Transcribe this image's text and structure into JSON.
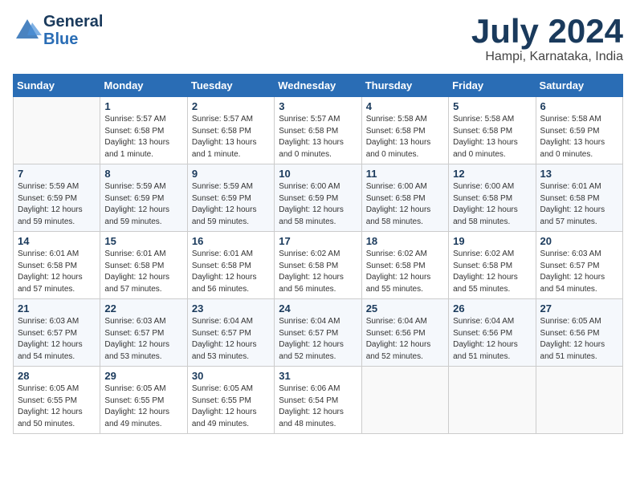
{
  "header": {
    "logo_general": "General",
    "logo_blue": "Blue",
    "title": "July 2024",
    "location": "Hampi, Karnataka, India"
  },
  "days_of_week": [
    "Sunday",
    "Monday",
    "Tuesday",
    "Wednesday",
    "Thursday",
    "Friday",
    "Saturday"
  ],
  "weeks": [
    [
      {
        "day": "",
        "info": ""
      },
      {
        "day": "1",
        "info": "Sunrise: 5:57 AM\nSunset: 6:58 PM\nDaylight: 13 hours\nand 1 minute."
      },
      {
        "day": "2",
        "info": "Sunrise: 5:57 AM\nSunset: 6:58 PM\nDaylight: 13 hours\nand 1 minute."
      },
      {
        "day": "3",
        "info": "Sunrise: 5:57 AM\nSunset: 6:58 PM\nDaylight: 13 hours\nand 0 minutes."
      },
      {
        "day": "4",
        "info": "Sunrise: 5:58 AM\nSunset: 6:58 PM\nDaylight: 13 hours\nand 0 minutes."
      },
      {
        "day": "5",
        "info": "Sunrise: 5:58 AM\nSunset: 6:58 PM\nDaylight: 13 hours\nand 0 minutes."
      },
      {
        "day": "6",
        "info": "Sunrise: 5:58 AM\nSunset: 6:59 PM\nDaylight: 13 hours\nand 0 minutes."
      }
    ],
    [
      {
        "day": "7",
        "info": "Sunrise: 5:59 AM\nSunset: 6:59 PM\nDaylight: 12 hours\nand 59 minutes."
      },
      {
        "day": "8",
        "info": "Sunrise: 5:59 AM\nSunset: 6:59 PM\nDaylight: 12 hours\nand 59 minutes."
      },
      {
        "day": "9",
        "info": "Sunrise: 5:59 AM\nSunset: 6:59 PM\nDaylight: 12 hours\nand 59 minutes."
      },
      {
        "day": "10",
        "info": "Sunrise: 6:00 AM\nSunset: 6:59 PM\nDaylight: 12 hours\nand 58 minutes."
      },
      {
        "day": "11",
        "info": "Sunrise: 6:00 AM\nSunset: 6:58 PM\nDaylight: 12 hours\nand 58 minutes."
      },
      {
        "day": "12",
        "info": "Sunrise: 6:00 AM\nSunset: 6:58 PM\nDaylight: 12 hours\nand 58 minutes."
      },
      {
        "day": "13",
        "info": "Sunrise: 6:01 AM\nSunset: 6:58 PM\nDaylight: 12 hours\nand 57 minutes."
      }
    ],
    [
      {
        "day": "14",
        "info": "Sunrise: 6:01 AM\nSunset: 6:58 PM\nDaylight: 12 hours\nand 57 minutes."
      },
      {
        "day": "15",
        "info": "Sunrise: 6:01 AM\nSunset: 6:58 PM\nDaylight: 12 hours\nand 57 minutes."
      },
      {
        "day": "16",
        "info": "Sunrise: 6:01 AM\nSunset: 6:58 PM\nDaylight: 12 hours\nand 56 minutes."
      },
      {
        "day": "17",
        "info": "Sunrise: 6:02 AM\nSunset: 6:58 PM\nDaylight: 12 hours\nand 56 minutes."
      },
      {
        "day": "18",
        "info": "Sunrise: 6:02 AM\nSunset: 6:58 PM\nDaylight: 12 hours\nand 55 minutes."
      },
      {
        "day": "19",
        "info": "Sunrise: 6:02 AM\nSunset: 6:58 PM\nDaylight: 12 hours\nand 55 minutes."
      },
      {
        "day": "20",
        "info": "Sunrise: 6:03 AM\nSunset: 6:57 PM\nDaylight: 12 hours\nand 54 minutes."
      }
    ],
    [
      {
        "day": "21",
        "info": "Sunrise: 6:03 AM\nSunset: 6:57 PM\nDaylight: 12 hours\nand 54 minutes."
      },
      {
        "day": "22",
        "info": "Sunrise: 6:03 AM\nSunset: 6:57 PM\nDaylight: 12 hours\nand 53 minutes."
      },
      {
        "day": "23",
        "info": "Sunrise: 6:04 AM\nSunset: 6:57 PM\nDaylight: 12 hours\nand 53 minutes."
      },
      {
        "day": "24",
        "info": "Sunrise: 6:04 AM\nSunset: 6:57 PM\nDaylight: 12 hours\nand 52 minutes."
      },
      {
        "day": "25",
        "info": "Sunrise: 6:04 AM\nSunset: 6:56 PM\nDaylight: 12 hours\nand 52 minutes."
      },
      {
        "day": "26",
        "info": "Sunrise: 6:04 AM\nSunset: 6:56 PM\nDaylight: 12 hours\nand 51 minutes."
      },
      {
        "day": "27",
        "info": "Sunrise: 6:05 AM\nSunset: 6:56 PM\nDaylight: 12 hours\nand 51 minutes."
      }
    ],
    [
      {
        "day": "28",
        "info": "Sunrise: 6:05 AM\nSunset: 6:55 PM\nDaylight: 12 hours\nand 50 minutes."
      },
      {
        "day": "29",
        "info": "Sunrise: 6:05 AM\nSunset: 6:55 PM\nDaylight: 12 hours\nand 49 minutes."
      },
      {
        "day": "30",
        "info": "Sunrise: 6:05 AM\nSunset: 6:55 PM\nDaylight: 12 hours\nand 49 minutes."
      },
      {
        "day": "31",
        "info": "Sunrise: 6:06 AM\nSunset: 6:54 PM\nDaylight: 12 hours\nand 48 minutes."
      },
      {
        "day": "",
        "info": ""
      },
      {
        "day": "",
        "info": ""
      },
      {
        "day": "",
        "info": ""
      }
    ]
  ]
}
